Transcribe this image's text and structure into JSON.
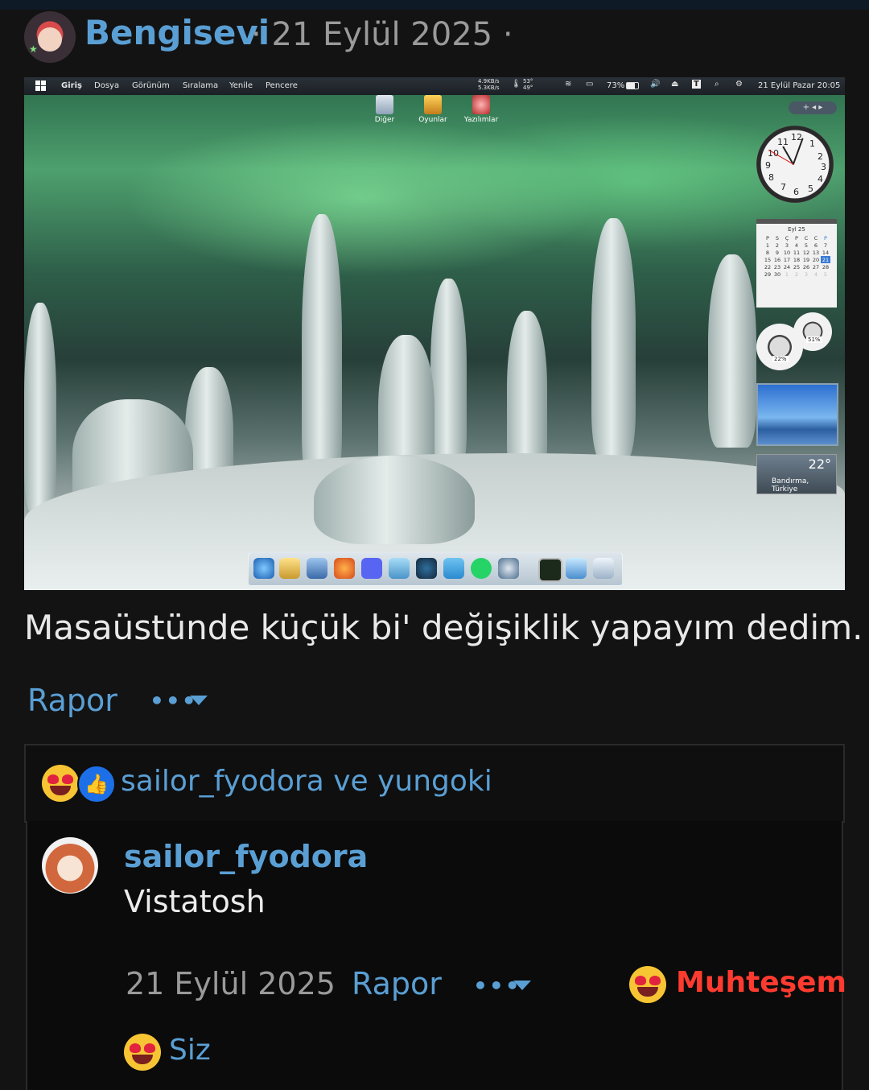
{
  "post": {
    "author": "Bengisevi",
    "date": "21 Eylül 2025",
    "separator": "·",
    "caption": "Masaüstünde küçük bi' değişiklik yapayım dedim.",
    "report_label": "Rapor",
    "more_label": "•••"
  },
  "screenshot": {
    "menu": [
      "Giriş",
      "Dosya",
      "Görünüm",
      "Sıralama",
      "Yenile",
      "Pencere"
    ],
    "status": {
      "net_up": "4.9KB/s",
      "net_down": "5.3KB/s",
      "temp_a": "53°",
      "temp_b": "49°",
      "battery": "73%",
      "datetime": "21 Eylül Pazar 20:05"
    },
    "desktop_icons": [
      "Diğer",
      "Oyunlar",
      "Yazılımlar"
    ],
    "calendar": {
      "title": "Eyl 25",
      "weekdays": [
        "P",
        "S",
        "Ç",
        "P",
        "C",
        "C",
        "P"
      ],
      "rows": [
        [
          "1",
          "2",
          "3",
          "4",
          "5",
          "6",
          "7"
        ],
        [
          "8",
          "9",
          "10",
          "11",
          "12",
          "13",
          "14"
        ],
        [
          "15",
          "16",
          "17",
          "18",
          "19",
          "20",
          "21"
        ],
        [
          "22",
          "23",
          "24",
          "25",
          "26",
          "27",
          "28"
        ],
        [
          "29",
          "30",
          "1",
          "2",
          "3",
          "4",
          "5"
        ]
      ],
      "today": "21"
    },
    "meters": [
      "22%",
      "51%"
    ],
    "weather": {
      "temp": "22°",
      "location": "Bandırma, Türkiye"
    },
    "clock_numbers": [
      "12",
      "1",
      "2",
      "3",
      "4",
      "5",
      "6",
      "7",
      "8",
      "9",
      "10",
      "11"
    ]
  },
  "reactions": {
    "users": "sailor_fyodora ve yungoki"
  },
  "comment": {
    "author": "sailor_fyodora",
    "text": "Vistatosh",
    "date": "21 Eylül 2025",
    "report_label": "Rapor",
    "more_label": "•••",
    "reaction_label": "Muhteşem",
    "my_reaction_label": "Siz"
  },
  "colors": {
    "link": "#5a9fd4",
    "danger": "#ff3b30",
    "background": "#131313"
  }
}
